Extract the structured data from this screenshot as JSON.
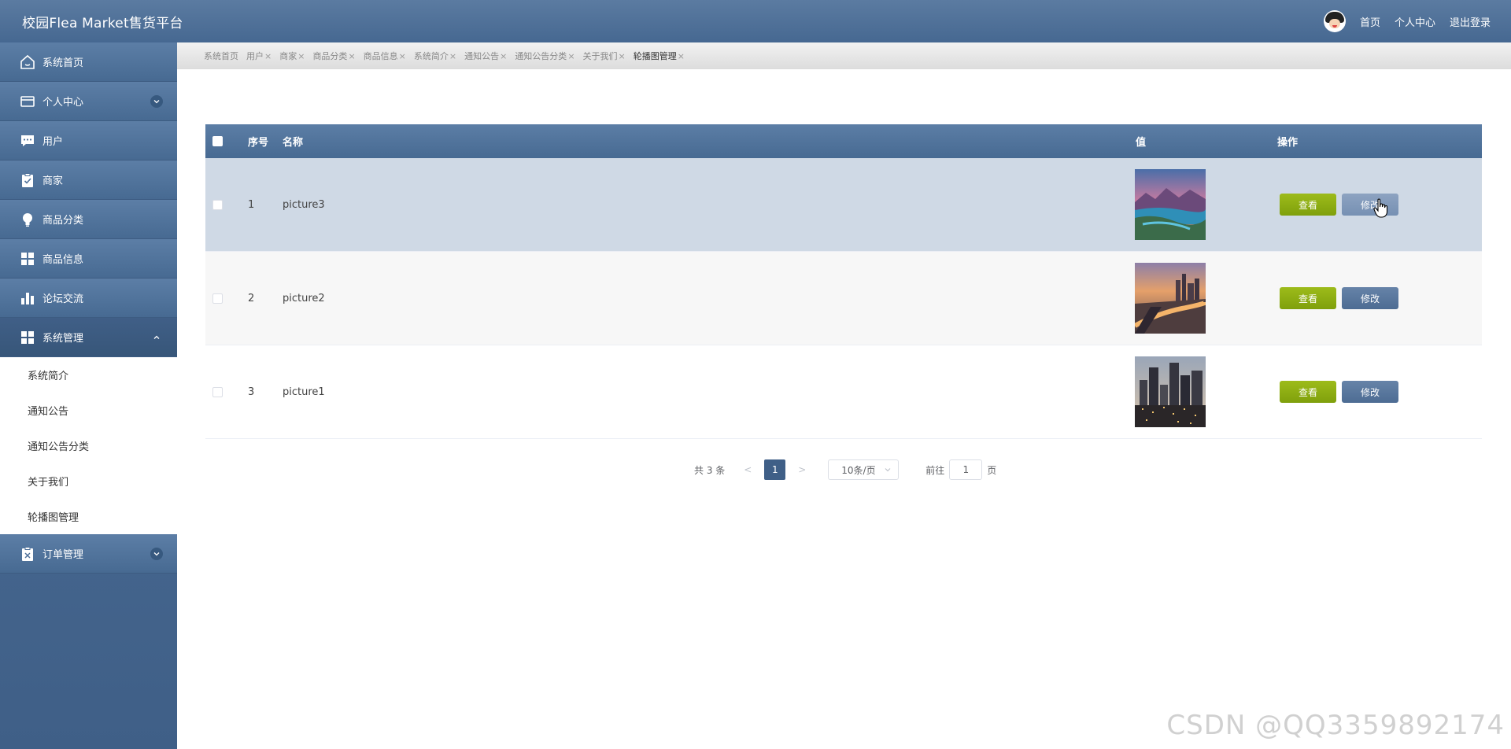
{
  "header": {
    "title": "校园Flea Market售货平台",
    "links": [
      "首页",
      "个人中心",
      "退出登录"
    ]
  },
  "sidebar": {
    "items": [
      {
        "label": "系统首页",
        "icon": "home-icon"
      },
      {
        "label": "个人中心",
        "icon": "card-icon",
        "expandable": true
      },
      {
        "label": "用户",
        "icon": "chat-icon"
      },
      {
        "label": "商家",
        "icon": "clipboard-check-icon"
      },
      {
        "label": "商品分类",
        "icon": "bulb-icon"
      },
      {
        "label": "商品信息",
        "icon": "grid-icon"
      },
      {
        "label": "论坛交流",
        "icon": "bar-chart-icon"
      },
      {
        "label": "系统管理",
        "icon": "grid-icon",
        "expanded": true
      },
      {
        "label": "订单管理",
        "icon": "clipboard-x-icon",
        "expandable": true
      }
    ],
    "submenu": [
      "系统简介",
      "通知公告",
      "通知公告分类",
      "关于我们",
      "轮播图管理"
    ]
  },
  "tabs": [
    "系统首页",
    "用户",
    "商家",
    "商品分类",
    "商品信息",
    "系统简介",
    "通知公告",
    "通知公告分类",
    "关于我们",
    "轮播图管理"
  ],
  "table": {
    "headers": {
      "index": "序号",
      "name": "名称",
      "value": "值",
      "action": "操作"
    },
    "rows": [
      {
        "index": "1",
        "name": "picture3",
        "view": "查看",
        "edit": "修改"
      },
      {
        "index": "2",
        "name": "picture2",
        "view": "查看",
        "edit": "修改"
      },
      {
        "index": "3",
        "name": "picture1",
        "view": "查看",
        "edit": "修改"
      }
    ]
  },
  "pagination": {
    "total": "共 3 条",
    "prev": "<",
    "current": "1",
    "next": ">",
    "page_size": "10条/页",
    "goto_label": "前往",
    "goto_value": "1",
    "page_suffix": "页"
  },
  "watermark": "CSDN @QQ3359892174",
  "colors": {
    "header": "#4f719a",
    "view_button": "#8bab12",
    "edit_button": "#5a7aa0",
    "selected_row": "#cfd9e5"
  }
}
